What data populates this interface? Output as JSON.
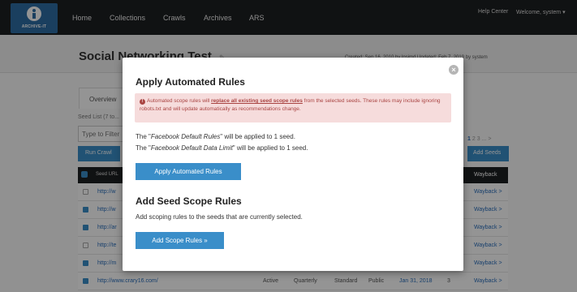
{
  "nav": {
    "logo_text": "ARCHIVE-IT",
    "links": [
      "Home",
      "Collections",
      "Crawls",
      "Archives",
      "ARS"
    ],
    "help": "Help Center",
    "welcome": "Welcome, system",
    "caret": "▾"
  },
  "page": {
    "title": "Social Networking Test",
    "meta": "Created: Sep 16, 2010 by lpsimd   Updated: Feb 7, 2019 by system",
    "tab_overview": "Overview",
    "seed_list_label": "Seed List (7 to...",
    "filter_placeholder": "Type to Filter",
    "run_crawl": "Run Crawl",
    "pager": {
      "current": "1",
      "rest": "2  3  ...  >"
    },
    "add_seeds": "Add Seeds",
    "table": {
      "seed_url_header": "Seed URL",
      "s_header": "s",
      "wayback_header": "Wayback",
      "rows": [
        {
          "checked": false,
          "url": "http://w",
          "wayback": "Wayback >"
        },
        {
          "checked": true,
          "url": "http://w",
          "wayback": "Wayback >"
        },
        {
          "checked": true,
          "url": "http://ar",
          "wayback": "Wayback >"
        },
        {
          "checked": false,
          "url": "http://te",
          "wayback": "Wayback >"
        },
        {
          "checked": true,
          "url": "http://m",
          "wayback": "Wayback >"
        },
        {
          "checked": true,
          "url": "http://www.crary16.com/",
          "status": "Active",
          "frequency": "Quarterly",
          "type": "Standard",
          "access": "Public",
          "date": "Jan 31, 2018",
          "count": "3",
          "wayback": "Wayback >"
        }
      ]
    }
  },
  "modal": {
    "close": "×",
    "title": "Apply Automated Rules",
    "alert": {
      "icon": "!",
      "text_before": "Automated scope rules will ",
      "emphasis": "replace all existing seed scope rules",
      "text_after": " from the selected seeds. These rules may include ignoring robots.txt and will update automatically as recommendations change."
    },
    "line1": {
      "pre": "The \"",
      "name": "Facebook Default Rules",
      "post": "\" will be applied to 1 seed."
    },
    "line2": {
      "pre": "The \"",
      "name": "Facebook Default Data Limit",
      "post": "\" will be applied to 1 seed."
    },
    "apply_button": "Apply Automated Rules",
    "section2_title": "Add Seed Scope Rules",
    "section2_sub": "Add scoping rules to the seeds that are currently selected.",
    "add_button": "Add Scope Rules »"
  },
  "colors": {
    "primary": "#3a8ec9",
    "nav": "#1d1f21",
    "alert_bg": "#f6dcdc",
    "alert_text": "#a94442"
  }
}
